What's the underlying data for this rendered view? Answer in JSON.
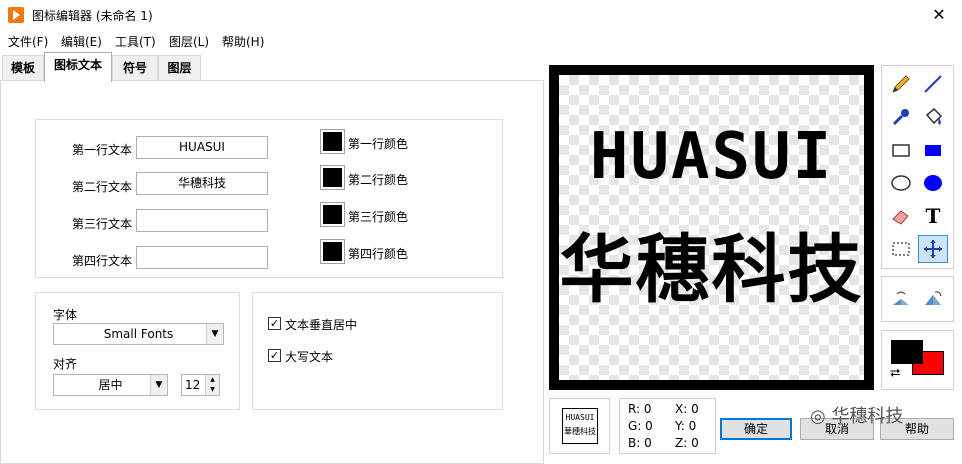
{
  "window": {
    "title": "图标编辑器 (未命名 1)",
    "close_glyph": "✕"
  },
  "menu": [
    "文件(F)",
    "编辑(E)",
    "工具(T)",
    "图层(L)",
    "帮助(H)"
  ],
  "tabs": [
    {
      "label": "模板",
      "active": false
    },
    {
      "label": "图标文本",
      "active": true
    },
    {
      "label": "符号",
      "active": false
    },
    {
      "label": "图层",
      "active": false
    }
  ],
  "text_lines": [
    {
      "label": "第一行文本",
      "value": "HUASUI",
      "color_label": "第一行颜色",
      "color": "#000000"
    },
    {
      "label": "第二行文本",
      "value": "华穗科技",
      "color_label": "第二行颜色",
      "color": "#000000"
    },
    {
      "label": "第三行文本",
      "value": "",
      "color_label": "第三行颜色",
      "color": "#000000"
    },
    {
      "label": "第四行文本",
      "value": "",
      "color_label": "第四行颜色",
      "color": "#000000"
    }
  ],
  "font": {
    "label": "字体",
    "value": "Small Fonts"
  },
  "align": {
    "label": "对齐",
    "value": "居中",
    "size": "12"
  },
  "options": [
    {
      "label": "文本垂直居中",
      "checked": true
    },
    {
      "label": "大写文本",
      "checked": true
    }
  ],
  "canvas": {
    "line1": "HUASUI",
    "line2": "华穗科技",
    "border_color": "#000000"
  },
  "tools": [
    "pencil-icon",
    "line-icon",
    "dropper-icon",
    "fill-bucket-icon",
    "rectangle-icon",
    "filled-rectangle-icon",
    "ellipse-icon",
    "filled-ellipse-icon",
    "eraser-icon",
    "text-tool-icon",
    "select-icon",
    "move-icon"
  ],
  "colors": {
    "foreground": "#000000",
    "background": "#ff0000"
  },
  "preview": {
    "line1": "HUASUI",
    "line2": "華穗科技"
  },
  "coords": {
    "r": "R: 0",
    "g": "G: 0",
    "b": "B: 0",
    "x": "X: 0",
    "y": "Y: 0",
    "z": "Z: 0"
  },
  "buttons": {
    "ok": "确定",
    "cancel": "取消",
    "help": "帮助"
  },
  "watermark": "华穗科技"
}
